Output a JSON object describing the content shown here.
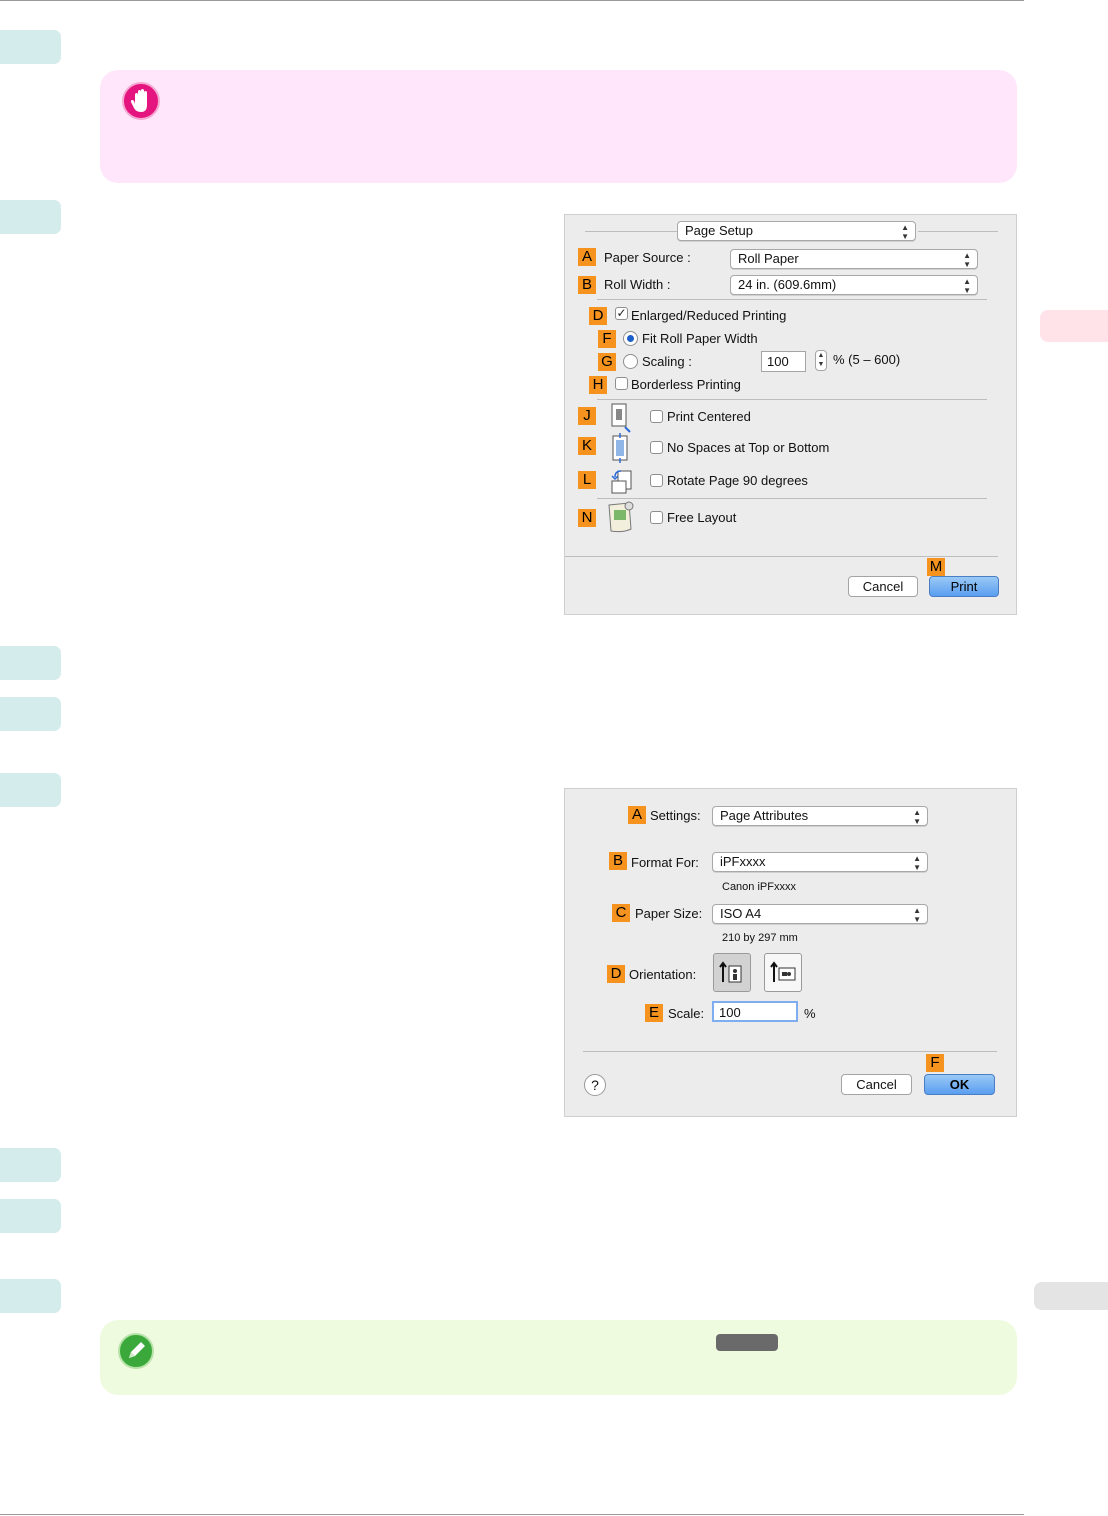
{
  "dialog1": {
    "panel_popup": "Page Setup",
    "paper_source": {
      "letter": "A",
      "label": "Paper Source :",
      "value": "Roll Paper"
    },
    "roll_width": {
      "letter": "B",
      "label": "Roll Width :",
      "value": "24 in. (609.6mm)"
    },
    "enlarged": {
      "letter": "D",
      "label": "Enlarged/Reduced Printing",
      "checked": true
    },
    "fit_roll": {
      "letter": "F",
      "label": "Fit Roll Paper Width",
      "selected": true
    },
    "scaling": {
      "letter": "G",
      "label": "Scaling :",
      "value": "100",
      "range": "% (5 – 600)"
    },
    "borderless": {
      "letter": "H",
      "label": "Borderless Printing"
    },
    "print_centered": {
      "letter": "J",
      "label": "Print Centered"
    },
    "no_spaces": {
      "letter": "K",
      "label": "No Spaces at Top or Bottom"
    },
    "rotate": {
      "letter": "L",
      "label": "Rotate Page 90 degrees"
    },
    "free_layout": {
      "letter": "N",
      "label": "Free Layout"
    },
    "print_letter": "M",
    "cancel": "Cancel",
    "print": "Print"
  },
  "dialog2": {
    "settings": {
      "letter": "A",
      "label": "Settings:",
      "value": "Page Attributes"
    },
    "format_for": {
      "letter": "B",
      "label": "Format For:",
      "value": "iPFxxxx",
      "sub": "Canon iPFxxxx"
    },
    "paper_size": {
      "letter": "C",
      "label": "Paper Size:",
      "value": "ISO A4",
      "sub": "210 by 297 mm"
    },
    "orientation": {
      "letter": "D",
      "label": "Orientation:"
    },
    "scale": {
      "letter": "E",
      "label": "Scale:",
      "value": "100",
      "unit": "%"
    },
    "ok_letter": "F",
    "help": "?",
    "cancel": "Cancel",
    "ok": "OK"
  },
  "colors": {
    "accent_orange": "#f5931e",
    "step_tab": "#d5ecec",
    "important_bg": "#ffe6fa",
    "note_bg": "#eefbdf"
  }
}
